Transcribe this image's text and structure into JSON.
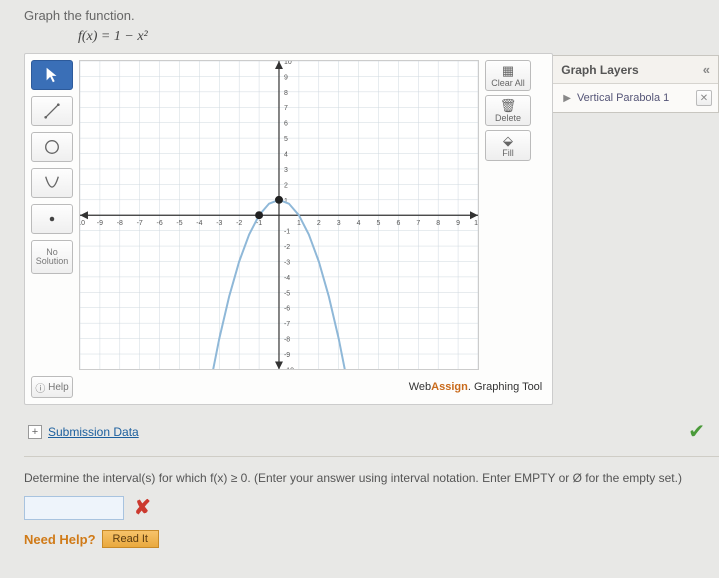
{
  "prompt": "Graph the function.",
  "formula": "f(x) = 1 − x²",
  "toolbar": {
    "pointer": "pointer",
    "line": "line",
    "circle": "circle",
    "parabola": "parabola",
    "point": "point",
    "no_solution_line1": "No",
    "no_solution_line2": "Solution",
    "help_label": "Help"
  },
  "right_buttons": {
    "clear_all": "Clear All",
    "delete": "Delete",
    "fill": "Fill"
  },
  "brand": {
    "pre": "Web",
    "bold": "Assign",
    "suffix": ". Graphing Tool"
  },
  "layers": {
    "title": "Graph Layers",
    "collapse": "«",
    "items": [
      {
        "label": "Vertical Parabola 1"
      }
    ]
  },
  "submission_link": "Submission Data",
  "question2": "Determine the interval(s) for which f(x) ≥ 0. (Enter your answer using interval notation. Enter EMPTY or Ø for the empty set.)",
  "answer_value": "",
  "need_help": "Need Help?",
  "read_it": "Read It",
  "chart_data": {
    "type": "line",
    "title": "",
    "xlabel": "",
    "ylabel": "",
    "xlim": [
      -10,
      10
    ],
    "ylim": [
      -10,
      10
    ],
    "series": [
      {
        "name": "f(x)=1-x^2",
        "x": [
          -4,
          -3.5,
          -3,
          -2.5,
          -2,
          -1.5,
          -1,
          -0.5,
          0,
          0.5,
          1,
          1.5,
          2,
          2.5,
          3,
          3.5,
          4
        ],
        "y": [
          -15,
          -11.25,
          -8,
          -5.25,
          -3,
          -1.25,
          0,
          0.75,
          1,
          0.75,
          0,
          -1.25,
          -3,
          -5.25,
          -8,
          -11.25,
          -15
        ]
      }
    ],
    "points": [
      {
        "x": 0,
        "y": 1,
        "label": "vertex"
      },
      {
        "x": -1,
        "y": 0,
        "label": "root"
      }
    ],
    "grid": true
  }
}
